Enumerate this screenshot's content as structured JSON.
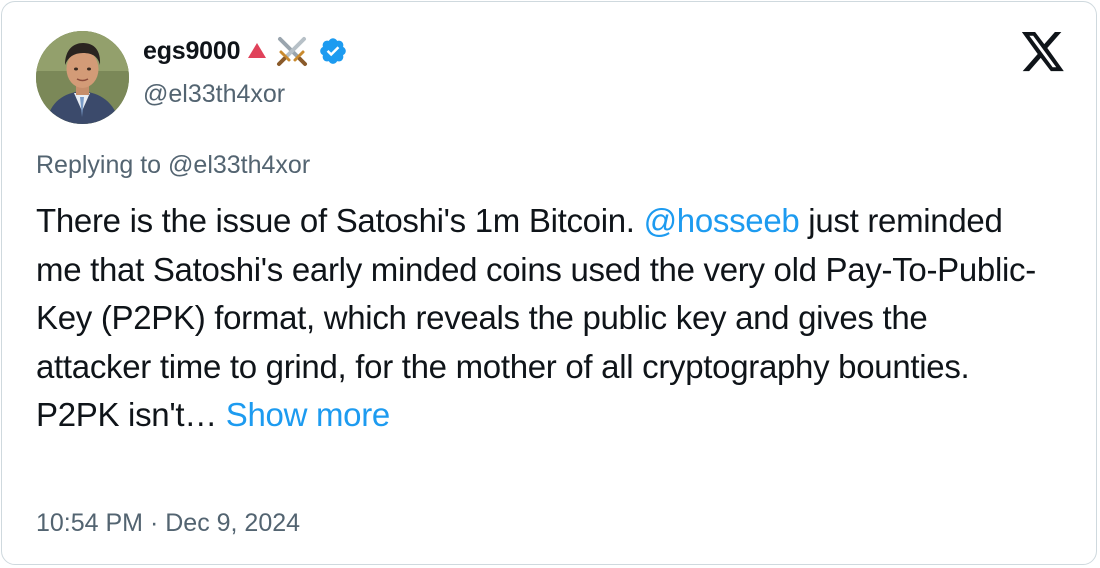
{
  "author": {
    "display_name": "egs9000",
    "handle": "@el33th4xor",
    "verified": true,
    "badge_emojis": [
      "red-triangle-icon",
      "crossed-swords-icon"
    ]
  },
  "reply": {
    "prefix": "Replying to ",
    "to": "@el33th4xor"
  },
  "tweet": {
    "text_part1": "There is the issue of Satoshi's 1m Bitcoin. ",
    "mention": "@hosseeb",
    "text_part2": " just reminded me that Satoshi's early minded coins used the very old Pay-To-Public-Key (P2PK) format, which reveals the public key and gives the attacker time to grind, for the mother of all cryptography bounties. P2PK isn't… ",
    "show_more": "Show more"
  },
  "meta": {
    "time": "10:54 PM",
    "separator": " · ",
    "date": "Dec 9, 2024"
  },
  "colors": {
    "link": "#1d9bf0",
    "secondary": "#536471",
    "primary": "#0f1419",
    "border": "#cfd9de",
    "verified": "#1d9bf0"
  },
  "icons": {
    "platform": "x-logo-icon",
    "verified": "verified-badge-icon"
  }
}
